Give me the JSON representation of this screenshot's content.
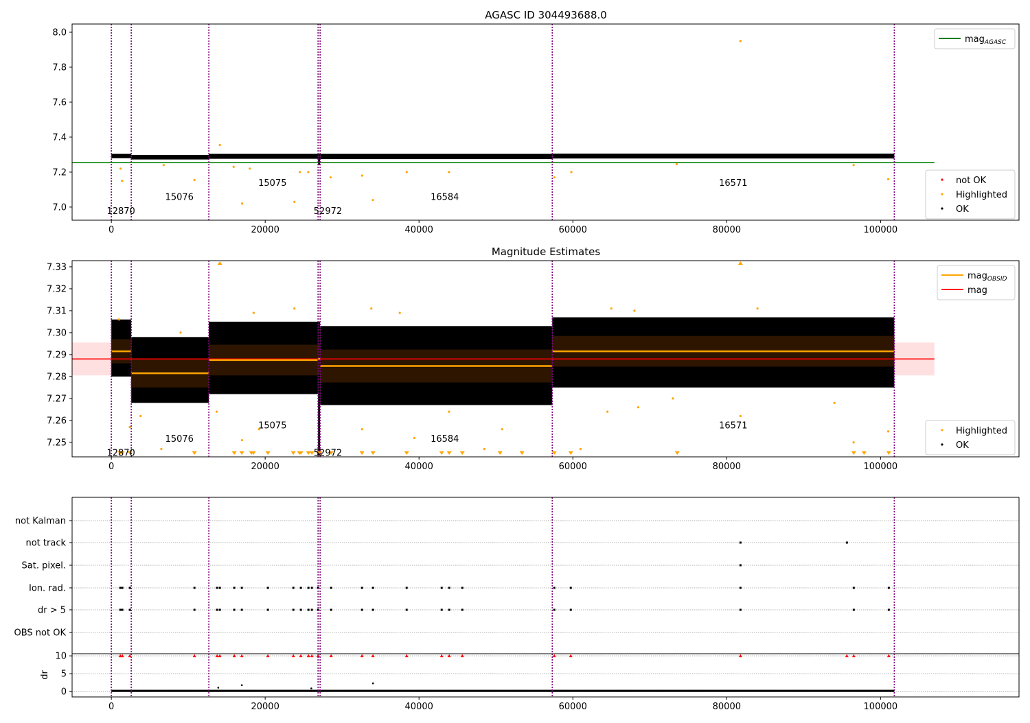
{
  "chart_data": [
    {
      "type": "scatter",
      "title": "AGASC ID 304493688.0",
      "xlim": [
        -5100,
        118000
      ],
      "ylim": [
        6.925,
        8.047
      ],
      "yticks": [
        7.0,
        7.2,
        7.4,
        7.6,
        7.8,
        8.0
      ],
      "ytick_labels": [
        "7.0",
        "7.2",
        "7.4",
        "7.6",
        "7.8",
        "8.0"
      ],
      "xticks": [
        0,
        20000,
        40000,
        60000,
        80000,
        100000
      ],
      "xtick_labels": [
        "0",
        "20000",
        "40000",
        "60000",
        "80000",
        "100000"
      ],
      "agasc_mag": 7.255,
      "agasc_line_xrange": [
        -5100,
        107000
      ],
      "ok_band": [
        {
          "x0": 0,
          "x1": 2589,
          "lo": 7.28,
          "hi": 7.305
        },
        {
          "x0": 2589,
          "x1": 12679,
          "lo": 7.272,
          "hi": 7.298
        },
        {
          "x0": 12679,
          "x1": 26875,
          "lo": 7.276,
          "hi": 7.305
        },
        {
          "x0": 26875,
          "x1": 27143,
          "lo": 7.24,
          "hi": 7.305
        },
        {
          "x0": 27143,
          "x1": 57321,
          "lo": 7.274,
          "hi": 7.305
        },
        {
          "x0": 57321,
          "x1": 101786,
          "lo": 7.278,
          "hi": 7.306
        }
      ],
      "highlighted": [
        [
          81786,
          7.95
        ],
        [
          14107,
          7.355
        ],
        [
          17000,
          7.02
        ],
        [
          23800,
          7.03
        ],
        [
          34000,
          7.04
        ],
        [
          1400,
          7.15
        ],
        [
          10800,
          7.155
        ],
        [
          18000,
          7.22
        ],
        [
          24500,
          7.2
        ],
        [
          28500,
          7.17
        ],
        [
          32600,
          7.18
        ],
        [
          38400,
          7.2
        ],
        [
          43900,
          7.2
        ],
        [
          59800,
          7.2
        ],
        [
          57600,
          7.17
        ],
        [
          101000,
          7.16
        ],
        [
          96500,
          7.24
        ],
        [
          73500,
          7.245
        ],
        [
          1200,
          7.22
        ],
        [
          6800,
          7.24
        ],
        [
          25600,
          7.2
        ],
        [
          15900,
          7.23
        ]
      ],
      "legend_upper": {
        "position": "upper right",
        "entries": [
          {
            "label": "mag",
            "sub": "AGASC",
            "color": "#008000"
          }
        ]
      },
      "legend_lower": {
        "position": "lower right",
        "entries": [
          {
            "label": "not OK",
            "color": "#ff0000"
          },
          {
            "label": "Highlighted",
            "color": "#ffa500"
          },
          {
            "label": "OK",
            "color": "#000000"
          }
        ]
      },
      "obsid_labels": [
        {
          "text": "12870",
          "x": 0,
          "y": 6.98
        },
        {
          "text": "15076",
          "x": 7600,
          "y": 7.06
        },
        {
          "text": "15075",
          "x": 19700,
          "y": 7.14
        },
        {
          "text": "52972",
          "x": 26900,
          "y": 6.98
        },
        {
          "text": "16584",
          "x": 42100,
          "y": 7.06
        },
        {
          "text": "16571",
          "x": 79600,
          "y": 7.14
        }
      ]
    },
    {
      "type": "scatter",
      "title": "Magnitude Estimates",
      "xlim": [
        -5100,
        118000
      ],
      "ylim": [
        7.2434,
        7.3328
      ],
      "yticks": [
        7.25,
        7.26,
        7.27,
        7.28,
        7.29,
        7.3,
        7.31,
        7.32,
        7.33
      ],
      "ytick_labels": [
        "7.25",
        "7.26",
        "7.27",
        "7.28",
        "7.29",
        "7.30",
        "7.31",
        "7.32",
        "7.33"
      ],
      "xticks": [
        0,
        20000,
        40000,
        60000,
        80000,
        100000
      ],
      "xtick_labels": [
        "0",
        "20000",
        "40000",
        "60000",
        "80000",
        "100000"
      ],
      "mag": 7.288,
      "mag_band": [
        7.2805,
        7.2955
      ],
      "mag_line_xrange": [
        -5100,
        107000
      ],
      "segments": [
        {
          "obsid": "12870",
          "x0": 0,
          "x1": 2589,
          "mean": 7.2915,
          "std": 0.0055,
          "lo": 7.28,
          "hi": 7.306
        },
        {
          "obsid": "15076",
          "x0": 2589,
          "x1": 12679,
          "mean": 7.2815,
          "std": 0.0065,
          "lo": 7.268,
          "hi": 7.298
        },
        {
          "obsid": "15075",
          "x0": 12679,
          "x1": 26875,
          "mean": 7.2875,
          "std": 0.007,
          "lo": 7.272,
          "hi": 7.305
        },
        {
          "obsid": "52972",
          "x0": 26875,
          "x1": 27143,
          "mean": 7.288,
          "std": 0.007,
          "lo": 7.244,
          "hi": 7.305
        },
        {
          "obsid": "16584",
          "x0": 27143,
          "x1": 57321,
          "mean": 7.2848,
          "std": 0.0075,
          "lo": 7.267,
          "hi": 7.303
        },
        {
          "obsid": "16571",
          "x0": 57321,
          "x1": 101786,
          "mean": 7.2915,
          "std": 0.007,
          "lo": 7.275,
          "hi": 7.307
        }
      ],
      "highlighted": [
        [
          2400,
          7.257
        ],
        [
          3800,
          7.262
        ],
        [
          6500,
          7.247
        ],
        [
          13700,
          7.264
        ],
        [
          17000,
          7.251
        ],
        [
          19200,
          7.256
        ],
        [
          32600,
          7.256
        ],
        [
          39400,
          7.252
        ],
        [
          43900,
          7.264
        ],
        [
          48500,
          7.247
        ],
        [
          50800,
          7.256
        ],
        [
          61000,
          7.247
        ],
        [
          64500,
          7.264
        ],
        [
          81786,
          7.262
        ],
        [
          96500,
          7.25
        ],
        [
          101000,
          7.255
        ],
        [
          68500,
          7.266
        ],
        [
          73000,
          7.27
        ],
        [
          94000,
          7.268
        ],
        [
          65000,
          7.311
        ],
        [
          68000,
          7.31
        ],
        [
          23800,
          7.311
        ],
        [
          33800,
          7.311
        ],
        [
          18500,
          7.309
        ],
        [
          37500,
          7.309
        ],
        [
          84000,
          7.311
        ],
        [
          1000,
          7.306
        ],
        [
          9000,
          7.3
        ]
      ],
      "highlighted_above": [
        14107,
        81786
      ],
      "highlighted_below": [
        1161,
        1429,
        2411,
        10804,
        15982,
        16964,
        18214,
        18482,
        20357,
        23661,
        24464,
        24643,
        25625,
        26071,
        26875,
        27143,
        28571,
        32589,
        34018,
        38393,
        42946,
        43929,
        45625,
        50536,
        53393,
        57589,
        59732,
        73571,
        96518,
        97857,
        101071
      ],
      "legend_upper": {
        "position": "upper right",
        "entries": [
          {
            "label": "mag",
            "sub": "OBSID",
            "color": "#ffa500"
          },
          {
            "label": "mag",
            "sub": "",
            "color": "#ff0000"
          }
        ]
      },
      "legend_lower": {
        "position": "lower right",
        "entries": [
          {
            "label": "Highlighted",
            "color": "#ffa500"
          },
          {
            "label": "OK",
            "color": "#000000"
          }
        ]
      },
      "obsid_labels": [
        {
          "text": "12870",
          "x": 0,
          "y": 7.2455
        },
        {
          "text": "15076",
          "x": 7600,
          "y": 7.2518
        },
        {
          "text": "15075",
          "x": 19700,
          "y": 7.258
        },
        {
          "text": "52972",
          "x": 26900,
          "y": 7.2455
        },
        {
          "text": "16584",
          "x": 42100,
          "y": 7.2518
        },
        {
          "text": "16571",
          "x": 79600,
          "y": 7.258
        }
      ]
    },
    {
      "type": "scatter",
      "title": "",
      "xlim": [
        -5100,
        118000
      ],
      "xticks": [
        0,
        20000,
        40000,
        60000,
        80000,
        100000
      ],
      "xtick_labels": [
        "0",
        "20000",
        "40000",
        "60000",
        "80000",
        "100000"
      ],
      "flag_rows": [
        "not Kalman",
        "not track",
        "Sat. pixel.",
        "Ion. rad.",
        "dr > 5",
        "OBS not OK"
      ],
      "flags": {
        "not Kalman": [],
        "not track": [
          81786,
          95625
        ],
        "Sat. pixel.": [
          81786
        ],
        "Ion. rad.": [
          1161,
          1429,
          2411,
          10804,
          13750,
          14107,
          15982,
          16964,
          20357,
          23661,
          24643,
          25625,
          26071,
          26875,
          28571,
          32589,
          34018,
          38393,
          42946,
          43929,
          45625,
          57589,
          59732,
          81786,
          96518,
          101071
        ],
        "dr > 5": [
          1161,
          1429,
          2411,
          10804,
          13750,
          14107,
          15982,
          16964,
          20357,
          23661,
          24643,
          25625,
          26071,
          26875,
          28571,
          32589,
          34018,
          38393,
          42946,
          43929,
          45625,
          57589,
          59732,
          81786,
          96518,
          101071
        ],
        "OBS not OK": []
      },
      "dr_ylabel": "dr",
      "dr_ylim": [
        -1.5,
        10.6
      ],
      "dr_yticks": [
        0,
        5,
        10
      ],
      "dr_ytick_labels": [
        "0",
        "5",
        "10"
      ],
      "dr_clipped_at_10": [
        1161,
        1429,
        2411,
        10804,
        13750,
        14107,
        15982,
        16964,
        20357,
        23661,
        24643,
        25625,
        26071,
        26875,
        28571,
        32589,
        34018,
        38393,
        42946,
        43929,
        45625,
        57589,
        59732,
        81786,
        95625,
        96518,
        101071
      ],
      "dr_outliers": [
        [
          16964,
          1.8
        ],
        [
          34018,
          2.3
        ],
        [
          13900,
          1.1
        ],
        [
          26000,
          0.9
        ]
      ]
    }
  ],
  "obsid_boundaries": [
    0,
    2589,
    12679,
    26875,
    27143,
    57321,
    101786
  ],
  "colors": {
    "ok": "#000000",
    "highlighted": "#ffa500",
    "not_ok": "#ff0000",
    "boundary": "#800080",
    "agasc": "#008000",
    "mag": "#ff0000",
    "obsid_mag": "#ffa500"
  }
}
